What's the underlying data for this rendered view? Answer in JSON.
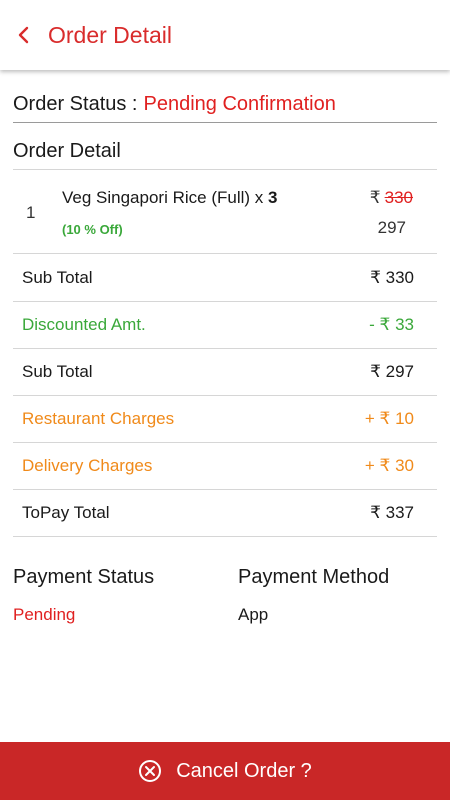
{
  "header": {
    "title": "Order Detail",
    "back_icon": "chevron-left-icon"
  },
  "status": {
    "label": "Order Status :",
    "value": "Pending Confirmation"
  },
  "section_title": "Order Detail",
  "item": {
    "qty": "1",
    "name": "Veg Singapori Rice (Full) x ",
    "count": "3",
    "discount": "(10 % Off)",
    "currency": "₹",
    "original_price": "330",
    "final_price": "297"
  },
  "summary": [
    {
      "label": "Sub Total",
      "value": "₹ 330",
      "color": "dark"
    },
    {
      "label": "Discounted Amt.",
      "value": "- ₹ 33",
      "color": "green"
    },
    {
      "label": "Sub Total",
      "value": "₹ 297",
      "color": "dark"
    },
    {
      "label": "Restaurant Charges",
      "value": "+ ₹ 10",
      "color": "orange"
    },
    {
      "label": "Delivery Charges",
      "value": "+ ₹ 30",
      "color": "orange"
    },
    {
      "label": "ToPay Total",
      "value": "₹ 337",
      "color": "dark"
    }
  ],
  "payment": {
    "status_label": "Payment Status",
    "status_value": "Pending",
    "method_label": "Payment Method",
    "method_value": "App"
  },
  "cancel": {
    "label": "Cancel Order ?",
    "icon": "close-circle-icon"
  },
  "colors": {
    "accent": "#d92c2c",
    "status": "#e02020",
    "green": "#3aa83a",
    "orange": "#f08a1a",
    "cancel_bg": "#c92727"
  }
}
